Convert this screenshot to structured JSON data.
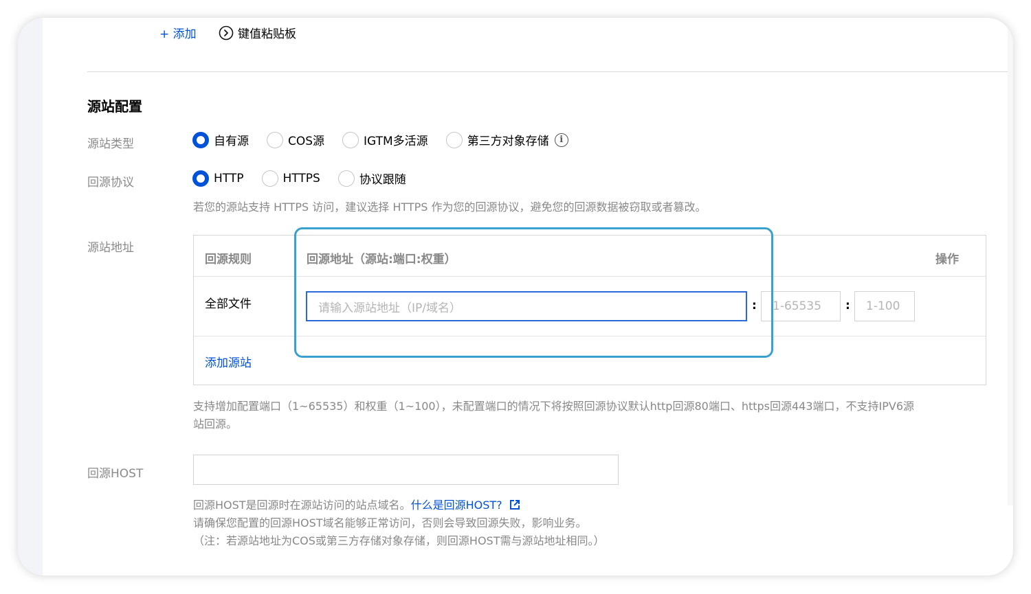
{
  "toolbar": {
    "add_label": "+ 添加",
    "clipboard_label": "键值粘贴板"
  },
  "origin_config": {
    "section_title": "源站配置",
    "type": {
      "label": "源站类型",
      "options": [
        {
          "label": "自有源",
          "checked": true
        },
        {
          "label": "COS源",
          "checked": false
        },
        {
          "label": "IGTM多活源",
          "checked": false
        },
        {
          "label": "第三方对象存储",
          "checked": false
        }
      ]
    },
    "protocol": {
      "label": "回源协议",
      "options": [
        {
          "label": "HTTP",
          "checked": true
        },
        {
          "label": "HTTPS",
          "checked": false
        },
        {
          "label": "协议跟随",
          "checked": false
        }
      ],
      "hint": "若您的源站支持 HTTPS 访问，建议选择 HTTPS 作为您的回源协议，避免您的回源数据被窃取或者篡改。"
    },
    "address": {
      "label": "源站地址",
      "columns": {
        "rule": "回源规则",
        "address": "回源地址（源站:端口:权重）",
        "action": "操作"
      },
      "row": {
        "rule": "全部文件",
        "address_placeholder": "请输入源站地址（IP/域名）",
        "port_placeholder": "1-65535",
        "weight_placeholder": "1-100",
        "separator": ":"
      },
      "add_origin_label": "添加源站",
      "hint_line1": "支持增加配置端口（1~65535）和权重（1~100），未配置端口的情况下将按照回源协议默认http回源80端口、https回源443端口，不支持IPV6源",
      "hint_line2": "站回源。"
    },
    "host": {
      "label": "回源HOST",
      "value": "",
      "hint1_prefix": "回源HOST是回源时在源站访问的站点域名。",
      "hint1_link": "什么是回源HOST?",
      "hint2": "请确保您配置的回源HOST域名能够正常访问，否则会导致回源失败，影响业务。",
      "hint3": "（注：若源站地址为COS或第三方存储对象存储，则回源HOST需与源站地址相同。）"
    }
  },
  "colors": {
    "primary": "#0052d9",
    "highlight_border": "#3aa0d0",
    "label_gray": "#8a8a8a"
  }
}
